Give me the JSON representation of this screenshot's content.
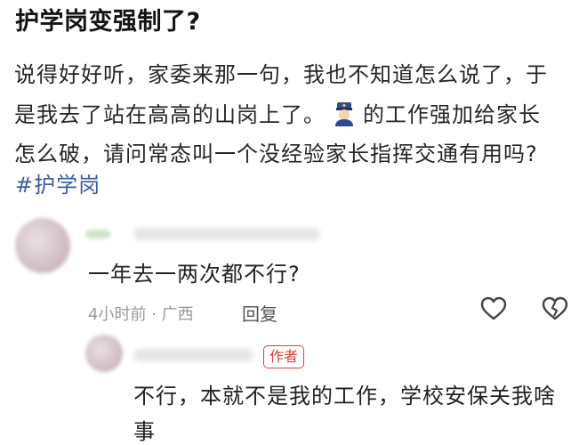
{
  "post": {
    "title": "护学岗变强制了?",
    "lines": [
      "说得好好听，家委来那一句，我也不知道怎么说了，于",
      "是我去了站在高高的山岗上了。",
      "的工作强加给家长",
      "怎么破，请问常态叫一个没经验家长指挥交通有用吗?"
    ],
    "tag": "#护学岗",
    "emoji_icon": "police-officer-icon"
  },
  "comments": [
    {
      "text": "一年去一两次都不行?",
      "time": "4小时前",
      "separator": "·",
      "location": "广西",
      "reply_label": "回复",
      "icons": [
        "heart-icon",
        "broken-heart-icon"
      ]
    },
    {
      "author_badge": "作者",
      "text_line1": "不行，本就不是我的工作，学校安保关我啥",
      "text_line2": "事"
    }
  ],
  "colors": {
    "tag": "#3b5d9e",
    "badge": "#e0403a",
    "meta": "#9a9a9a"
  }
}
